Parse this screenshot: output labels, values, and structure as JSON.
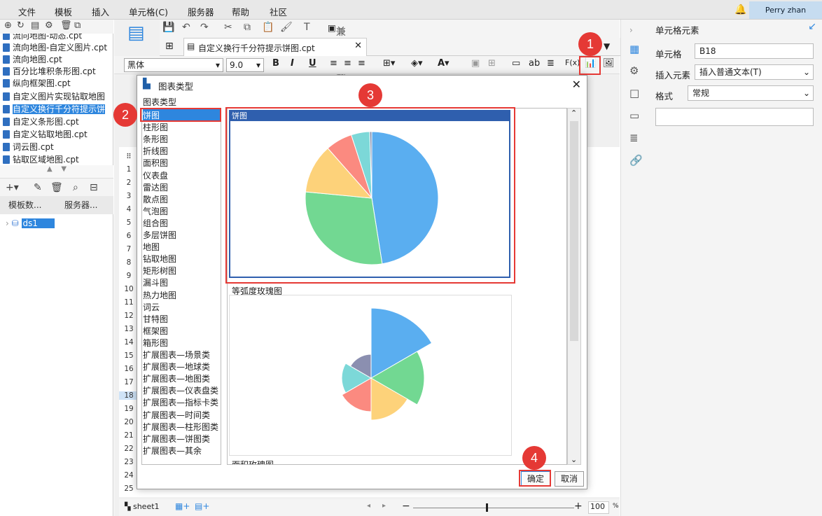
{
  "menu": {
    "items": [
      "文件",
      "模板",
      "插入",
      "单元格(C)",
      "服务器",
      "帮助",
      "社区"
    ],
    "user": "Perry zhan"
  },
  "files": [
    "流向地图-动态.cpt",
    "流向地图-自定义图片.cpt",
    "流向地图.cpt",
    "百分比堆积条形图.cpt",
    "纵向框架图.cpt",
    "自定义图片实现钻取地图",
    "自定义换行千分符提示饼",
    "自定义条形图.cpt",
    "自定义钻取地图.cpt",
    "词云图.cpt",
    "钻取区域地图.cpt"
  ],
  "left_tabs": [
    "模板数...",
    "服务器..."
  ],
  "datasource": "ds1",
  "toolbar": {
    "compat_theme": "兼容主题",
    "file_tab": "自定义换行千分符提示饼图.cpt",
    "font": "黑体",
    "size": "9.0"
  },
  "rows": [
    "1",
    "2",
    "3",
    "4",
    "5",
    "6",
    "7",
    "8",
    "9",
    "10",
    "11",
    "12",
    "13",
    "14",
    "15",
    "16",
    "17",
    "18",
    "19",
    "20",
    "21",
    "22",
    "23",
    "24",
    "25"
  ],
  "properties": {
    "title": "单元格元素",
    "cell_label": "单元格",
    "cell_value": "B18",
    "insert_label": "插入元素",
    "insert_value": "插入普通文本(T)",
    "format_label": "格式",
    "format_value": "常规"
  },
  "status": {
    "sheet": "sheet1",
    "zoom": "100",
    "pct": "%"
  },
  "dialog": {
    "title": "图表类型",
    "group": "图表类型",
    "types": [
      "饼图",
      "柱形图",
      "条形图",
      "折线图",
      "面积图",
      "仪表盘",
      "雷达图",
      "散点图",
      "气泡图",
      "组合图",
      "多层饼图",
      "地图",
      "钻取地图",
      "矩形树图",
      "漏斗图",
      "热力地图",
      "词云",
      "甘特图",
      "框架图",
      "箱形图",
      "扩展图表—场景类",
      "扩展图表—地球类",
      "扩展图表—地图类",
      "扩展图表—仪表盘类",
      "扩展图表—指标卡类",
      "扩展图表—时间类",
      "扩展图表—柱形图类",
      "扩展图表—饼图类",
      "扩展图表—其余"
    ],
    "preview1": "饼图",
    "preview2": "等弧度玫瑰图",
    "preview3": "面积玫瑰图",
    "ok": "确定",
    "cancel": "取消"
  },
  "badges": [
    "1",
    "2",
    "3",
    "4"
  ],
  "chart_data": [
    {
      "type": "pie",
      "title": "饼图",
      "slices": [
        47.5,
        29,
        12,
        6.5,
        4.5,
        0.5
      ],
      "colors": [
        "#5aaef0",
        "#72d892",
        "#fdd27a",
        "#fb8a80",
        "#7cd8d8",
        "#8090b0"
      ]
    },
    {
      "type": "pie",
      "title": "等弧度玫瑰图",
      "slices": [
        1,
        1,
        1,
        1,
        1,
        1
      ],
      "radius": [
        1,
        0.76,
        0.6,
        0.48,
        0.42,
        0.34
      ],
      "colors": [
        "#5aaef0",
        "#72d892",
        "#fdd27a",
        "#fb8a80",
        "#7cd8d8",
        "#8b8fb0"
      ]
    }
  ]
}
